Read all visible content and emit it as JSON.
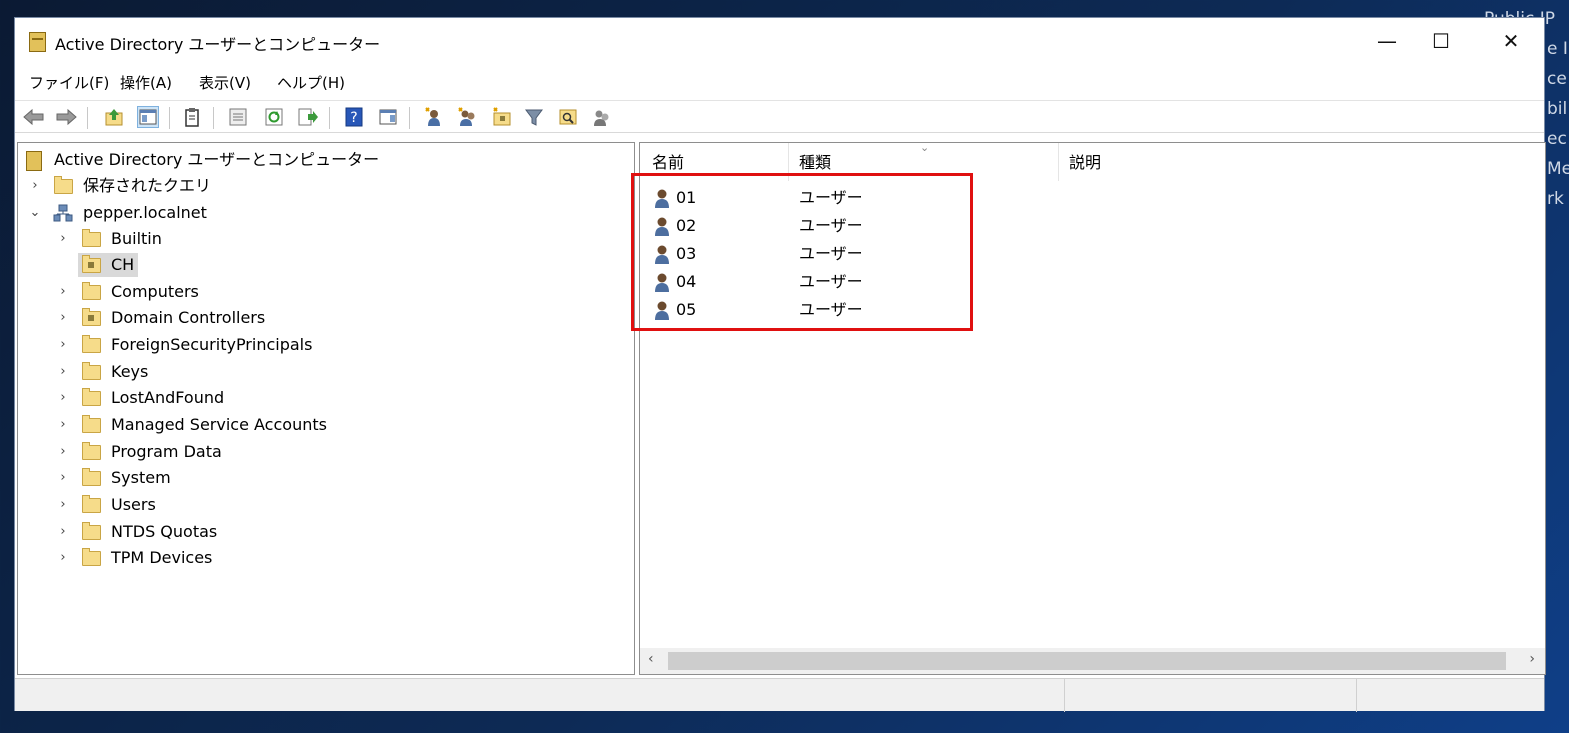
{
  "window": {
    "title": "Active Directory ユーザーとコンピューター",
    "minimize_glyph": "—",
    "maximize_glyph": "☐",
    "close_glyph": "✕"
  },
  "desktop_fragments": [
    "Public IP",
    "e I",
    "ce",
    "bil",
    "ec",
    "Me",
    "rk"
  ],
  "menu": {
    "items": [
      "ファイル(F)",
      "操作(A)",
      "表示(V)",
      "ヘルプ(H)"
    ]
  },
  "toolbar": {
    "icons": [
      "back-arrow-icon",
      "forward-arrow-icon",
      "up-folder-icon",
      "show-hide-tree-icon",
      "clipboard-icon",
      "properties-icon",
      "refresh-icon",
      "export-list-icon",
      "help-icon",
      "show-action-pane-icon",
      "create-user-icon",
      "create-group-icon",
      "create-ou-icon",
      "filter-icon",
      "find-icon",
      "add-to-group-icon"
    ]
  },
  "tree": {
    "root": "Active Directory ユーザーとコンピューター",
    "saved_queries": "保存されたクエリ",
    "domain": "pepper.localnet",
    "children": [
      "Builtin",
      "CH",
      "Computers",
      "Domain Controllers",
      "ForeignSecurityPrincipals",
      "Keys",
      "LostAndFound",
      "Managed Service Accounts",
      "Program Data",
      "System",
      "Users",
      "NTDS Quotas",
      "TPM Devices"
    ],
    "selected": "CH"
  },
  "list": {
    "columns": [
      "名前",
      "種類",
      "説明"
    ],
    "rows": [
      {
        "name": "01",
        "type": "ユーザー"
      },
      {
        "name": "02",
        "type": "ユーザー"
      },
      {
        "name": "03",
        "type": "ユーザー"
      },
      {
        "name": "04",
        "type": "ユーザー"
      },
      {
        "name": "05",
        "type": "ユーザー"
      }
    ]
  },
  "colors": {
    "highlight_box": "#e01010",
    "selection": "#d9d9d9",
    "folder": "#f6dc8a"
  }
}
